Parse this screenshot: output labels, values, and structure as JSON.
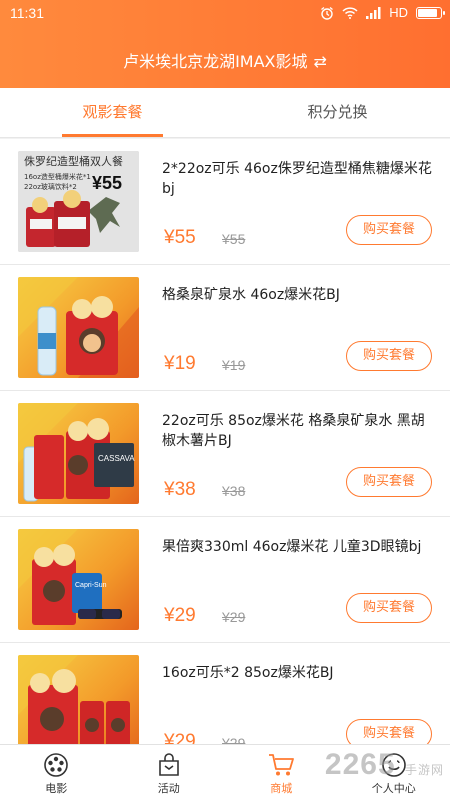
{
  "status": {
    "time": "11:31",
    "network": "HD"
  },
  "header": {
    "cinema": "卢米埃北京龙湖IMAX影城",
    "swap_icon": "swap-icon"
  },
  "tabs": [
    {
      "label": "观影套餐",
      "active": true
    },
    {
      "label": "积分兑换",
      "active": false
    }
  ],
  "items": [
    {
      "title": "2*22oz可乐 46oz侏罗纪造型桶焦糖爆米花bj",
      "price": "¥55",
      "orig": "¥55",
      "buy": "购买套餐",
      "image_text": {
        "line1": "侏罗纪造型桶双人餐",
        "line2": "16oz造型桶爆米花*1",
        "line3": "22oz玻璃饮料*2",
        "price": "¥55"
      }
    },
    {
      "title": "格桑泉矿泉水 46oz爆米花BJ",
      "price": "¥19",
      "orig": "¥19",
      "buy": "购买套餐"
    },
    {
      "title": "22oz可乐 85oz爆米花 格桑泉矿泉水 黑胡椒木薯片BJ",
      "price": "¥38",
      "orig": "¥38",
      "buy": "购买套餐"
    },
    {
      "title": "果倍爽330ml 46oz爆米花 儿童3D眼镜bj",
      "price": "¥29",
      "orig": "¥29",
      "buy": "购买套餐"
    },
    {
      "title": "16oz可乐*2 85oz爆米花BJ",
      "price": "¥29",
      "orig": "¥29",
      "buy": "购买套餐"
    }
  ],
  "tabbar": [
    {
      "label": "电影",
      "icon": "film-reel-icon",
      "active": false
    },
    {
      "label": "活动",
      "icon": "gift-bag-icon",
      "active": false
    },
    {
      "label": "商城",
      "icon": "cart-icon",
      "active": true
    },
    {
      "label": "个人中心",
      "icon": "user-icon",
      "active": false
    }
  ],
  "watermark": {
    "main": "2265",
    "sub": "手游网"
  },
  "colors": {
    "accent": "#ff7a30",
    "header": "#ff7f38"
  }
}
